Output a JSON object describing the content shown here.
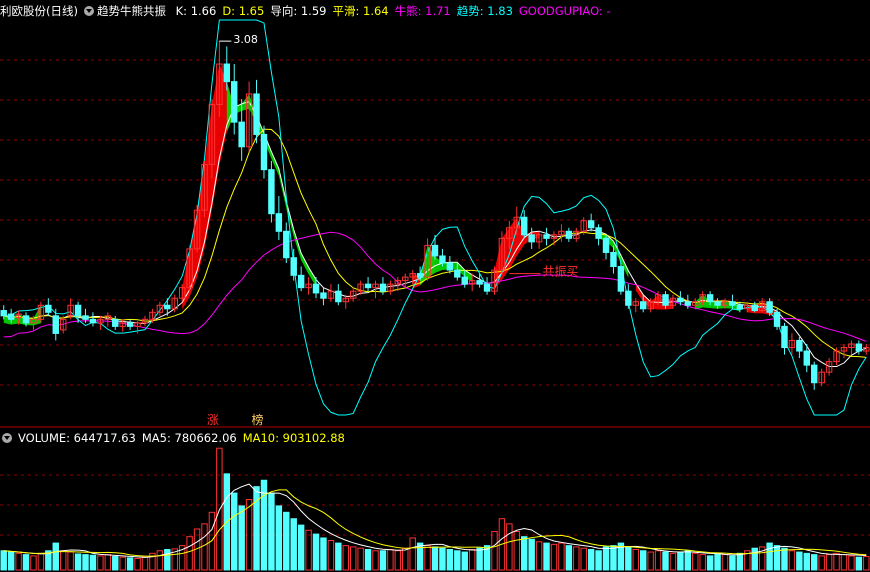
{
  "header_main": {
    "stock": "利欧股份(日线)",
    "indicator": "趋势牛熊共振",
    "items": [
      {
        "label": "K:",
        "value": "1.66",
        "color": "#ffffff"
      },
      {
        "label": "D:",
        "value": "1.65",
        "color": "#ffff00"
      },
      {
        "label": "导向:",
        "value": "1.59",
        "color": "#ffffff"
      },
      {
        "label": "平滑:",
        "value": "1.64",
        "color": "#ffff00"
      },
      {
        "label": "牛熊:",
        "value": "1.71",
        "color": "#ff00ff"
      },
      {
        "label": "趋势:",
        "value": "1.83",
        "color": "#00ffff"
      },
      {
        "label": "GOODGUPIAO:",
        "value": "-",
        "color": "#ff00ff"
      }
    ]
  },
  "header_volume": {
    "items": [
      {
        "label": "VOLUME:",
        "value": "644717.63",
        "color": "#ffffff"
      },
      {
        "label": "MA5:",
        "value": "780662.06",
        "color": "#ffffff"
      },
      {
        "label": "MA10:",
        "value": "903102.88",
        "color": "#ffff00"
      }
    ]
  },
  "annotations": {
    "peak_label": "3.08",
    "resonance_buy": "共振买",
    "limit_up": "涨",
    "ranking": "榜"
  },
  "colors": {
    "up": "#ff3232",
    "down": "#54ffff",
    "bull_band": "#ff0000",
    "bear_band": "#00dd00",
    "ma_white": "#ffffff",
    "ma_yellow": "#ffff00",
    "ma_magenta": "#ff00ff",
    "ma_cyan": "#00ffff"
  },
  "chart_data": [
    {
      "type": "candlestick",
      "title": "利欧股份(日线)",
      "price_range": [
        0.9,
        3.2
      ],
      "candles": [
        [
          1.55,
          1.58,
          1.5,
          1.52
        ],
        [
          1.53,
          1.56,
          1.48,
          1.5
        ],
        [
          1.51,
          1.55,
          1.47,
          1.53
        ],
        [
          1.52,
          1.54,
          1.46,
          1.48
        ],
        [
          1.48,
          1.52,
          1.44,
          1.5
        ],
        [
          1.5,
          1.6,
          1.48,
          1.58
        ],
        [
          1.58,
          1.62,
          1.52,
          1.54
        ],
        [
          1.52,
          1.56,
          1.38,
          1.42
        ],
        [
          1.44,
          1.52,
          1.42,
          1.5
        ],
        [
          1.52,
          1.62,
          1.5,
          1.58
        ],
        [
          1.58,
          1.6,
          1.48,
          1.52
        ],
        [
          1.52,
          1.56,
          1.48,
          1.5
        ],
        [
          1.5,
          1.54,
          1.46,
          1.48
        ],
        [
          1.48,
          1.52,
          1.44,
          1.5
        ],
        [
          1.5,
          1.54,
          1.46,
          1.52
        ],
        [
          1.5,
          1.52,
          1.44,
          1.46
        ],
        [
          1.46,
          1.5,
          1.43,
          1.48
        ],
        [
          1.48,
          1.5,
          1.44,
          1.46
        ],
        [
          1.46,
          1.49,
          1.42,
          1.48
        ],
        [
          1.48,
          1.52,
          1.46,
          1.5
        ],
        [
          1.5,
          1.56,
          1.48,
          1.54
        ],
        [
          1.54,
          1.6,
          1.52,
          1.58
        ],
        [
          1.58,
          1.62,
          1.52,
          1.56
        ],
        [
          1.56,
          1.64,
          1.54,
          1.62
        ],
        [
          1.62,
          1.7,
          1.6,
          1.68
        ],
        [
          1.68,
          1.92,
          1.66,
          1.9
        ],
        [
          1.9,
          2.15,
          1.88,
          2.12
        ],
        [
          2.12,
          2.4,
          2.08,
          2.38
        ],
        [
          2.38,
          2.75,
          2.3,
          2.72
        ],
        [
          2.72,
          3.08,
          2.65,
          2.95
        ],
        [
          2.95,
          3.05,
          2.8,
          2.85
        ],
        [
          2.85,
          2.95,
          2.55,
          2.62
        ],
        [
          2.62,
          2.75,
          2.4,
          2.48
        ],
        [
          2.48,
          2.85,
          2.45,
          2.78
        ],
        [
          2.78,
          2.86,
          2.5,
          2.55
        ],
        [
          2.55,
          2.6,
          2.3,
          2.35
        ],
        [
          2.35,
          2.4,
          2.05,
          2.1
        ],
        [
          2.1,
          2.2,
          1.95,
          2.0
        ],
        [
          2.0,
          2.05,
          1.82,
          1.85
        ],
        [
          1.85,
          1.9,
          1.72,
          1.75
        ],
        [
          1.75,
          1.8,
          1.66,
          1.68
        ],
        [
          1.68,
          1.74,
          1.64,
          1.7
        ],
        [
          1.7,
          1.74,
          1.62,
          1.65
        ],
        [
          1.65,
          1.68,
          1.58,
          1.62
        ],
        [
          1.62,
          1.7,
          1.6,
          1.66
        ],
        [
          1.66,
          1.7,
          1.58,
          1.6
        ],
        [
          1.6,
          1.64,
          1.56,
          1.62
        ],
        [
          1.62,
          1.68,
          1.6,
          1.66
        ],
        [
          1.66,
          1.72,
          1.64,
          1.7
        ],
        [
          1.7,
          1.74,
          1.66,
          1.68
        ],
        [
          1.68,
          1.72,
          1.62,
          1.7
        ],
        [
          1.7,
          1.74,
          1.64,
          1.66
        ],
        [
          1.66,
          1.72,
          1.64,
          1.7
        ],
        [
          1.7,
          1.74,
          1.66,
          1.72
        ],
        [
          1.72,
          1.76,
          1.68,
          1.74
        ],
        [
          1.74,
          1.78,
          1.7,
          1.76
        ],
        [
          1.76,
          1.8,
          1.72,
          1.74
        ],
        [
          1.74,
          1.96,
          1.72,
          1.92
        ],
        [
          1.92,
          1.98,
          1.84,
          1.86
        ],
        [
          1.86,
          1.9,
          1.8,
          1.82
        ],
        [
          1.82,
          1.86,
          1.76,
          1.78
        ],
        [
          1.78,
          1.82,
          1.72,
          1.74
        ],
        [
          1.74,
          1.78,
          1.68,
          1.7
        ],
        [
          1.7,
          1.76,
          1.66,
          1.72
        ],
        [
          1.72,
          1.76,
          1.68,
          1.7
        ],
        [
          1.7,
          1.74,
          1.64,
          1.66
        ],
        [
          1.66,
          1.8,
          1.64,
          1.78
        ],
        [
          1.78,
          2.0,
          1.76,
          1.96
        ],
        [
          1.96,
          2.06,
          1.9,
          2.02
        ],
        [
          2.02,
          2.14,
          1.98,
          2.08
        ],
        [
          2.08,
          2.12,
          1.96,
          1.98
        ],
        [
          1.98,
          2.02,
          1.9,
          1.94
        ],
        [
          1.94,
          2.0,
          1.9,
          1.98
        ],
        [
          1.98,
          2.02,
          1.92,
          1.96
        ],
        [
          1.96,
          2.0,
          1.92,
          1.98
        ],
        [
          1.98,
          2.04,
          1.94,
          2.0
        ],
        [
          2.0,
          2.02,
          1.94,
          1.96
        ],
        [
          1.96,
          2.02,
          1.94,
          2.0
        ],
        [
          2.0,
          2.08,
          1.98,
          2.06
        ],
        [
          2.06,
          2.1,
          2.0,
          2.02
        ],
        [
          2.02,
          2.04,
          1.92,
          1.96
        ],
        [
          1.96,
          1.98,
          1.84,
          1.88
        ],
        [
          1.88,
          1.92,
          1.76,
          1.8
        ],
        [
          1.8,
          1.82,
          1.64,
          1.66
        ],
        [
          1.66,
          1.7,
          1.56,
          1.58
        ],
        [
          1.58,
          1.62,
          1.54,
          1.6
        ],
        [
          1.6,
          1.64,
          1.54,
          1.56
        ],
        [
          1.56,
          1.62,
          1.54,
          1.6
        ],
        [
          1.6,
          1.66,
          1.58,
          1.64
        ],
        [
          1.64,
          1.66,
          1.56,
          1.58
        ],
        [
          1.58,
          1.64,
          1.56,
          1.62
        ],
        [
          1.62,
          1.66,
          1.58,
          1.6
        ],
        [
          1.6,
          1.64,
          1.56,
          1.58
        ],
        [
          1.58,
          1.62,
          1.56,
          1.6
        ],
        [
          1.6,
          1.66,
          1.58,
          1.64
        ],
        [
          1.64,
          1.66,
          1.58,
          1.6
        ],
        [
          1.6,
          1.62,
          1.56,
          1.58
        ],
        [
          1.58,
          1.62,
          1.56,
          1.6
        ],
        [
          1.6,
          1.64,
          1.56,
          1.58
        ],
        [
          1.58,
          1.6,
          1.54,
          1.56
        ],
        [
          1.56,
          1.6,
          1.54,
          1.58
        ],
        [
          1.58,
          1.6,
          1.54,
          1.55
        ],
        [
          1.55,
          1.62,
          1.54,
          1.6
        ],
        [
          1.6,
          1.62,
          1.52,
          1.54
        ],
        [
          1.54,
          1.56,
          1.44,
          1.46
        ],
        [
          1.46,
          1.48,
          1.3,
          1.34
        ],
        [
          1.34,
          1.42,
          1.3,
          1.38
        ],
        [
          1.38,
          1.4,
          1.28,
          1.32
        ],
        [
          1.32,
          1.36,
          1.2,
          1.24
        ],
        [
          1.24,
          1.26,
          1.1,
          1.14
        ],
        [
          1.14,
          1.22,
          1.12,
          1.2
        ],
        [
          1.2,
          1.28,
          1.18,
          1.26
        ],
        [
          1.26,
          1.34,
          1.24,
          1.32
        ],
        [
          1.32,
          1.36,
          1.28,
          1.34
        ],
        [
          1.34,
          1.38,
          1.3,
          1.36
        ],
        [
          1.36,
          1.38,
          1.3,
          1.32
        ],
        [
          1.32,
          1.36,
          1.3,
          1.34
        ]
      ],
      "bands": [
        {
          "name": "bull",
          "color": "#ff0000",
          "segments": [
            [
              24,
              31
            ],
            [
              55,
              58
            ],
            [
              66,
              72
            ],
            [
              85,
              90
            ],
            [
              100,
              104
            ]
          ]
        },
        {
          "name": "bear",
          "color": "#00dd00",
          "segments": [
            [
              0,
              5
            ],
            [
              30,
              42
            ],
            [
              56,
              63
            ],
            [
              80,
              84
            ],
            [
              93,
              99
            ]
          ]
        }
      ],
      "lines": [
        {
          "name": "ma_white",
          "color": "#ffffff"
        },
        {
          "name": "ma_yellow",
          "color": "#ffff00"
        },
        {
          "name": "ma_magenta",
          "color": "#ff00ff"
        },
        {
          "name": "ma_cyan",
          "color": "#00ffff"
        }
      ]
    },
    {
      "type": "bar",
      "title": "VOLUME",
      "volume": [
        300,
        280,
        260,
        240,
        220,
        260,
        300,
        420,
        300,
        280,
        250,
        240,
        230,
        220,
        240,
        210,
        200,
        190,
        180,
        200,
        260,
        300,
        320,
        330,
        380,
        520,
        640,
        720,
        900,
        1900,
        1500,
        1200,
        1000,
        1100,
        1300,
        1400,
        1200,
        1000,
        900,
        800,
        700,
        620,
        560,
        500,
        460,
        420,
        380,
        360,
        340,
        320,
        300,
        300,
        320,
        300,
        340,
        500,
        420,
        380,
        360,
        340,
        320,
        300,
        280,
        320,
        340,
        380,
        600,
        800,
        720,
        600,
        520,
        480,
        440,
        420,
        400,
        420,
        380,
        360,
        340,
        320,
        300,
        360,
        380,
        420,
        360,
        320,
        300,
        280,
        300,
        280,
        260,
        280,
        300,
        260,
        240,
        220,
        260,
        240,
        220,
        260,
        300,
        340,
        360,
        420,
        380,
        340,
        300,
        280,
        260,
        240,
        220,
        240,
        260,
        240,
        220,
        200,
        210
      ]
    }
  ]
}
